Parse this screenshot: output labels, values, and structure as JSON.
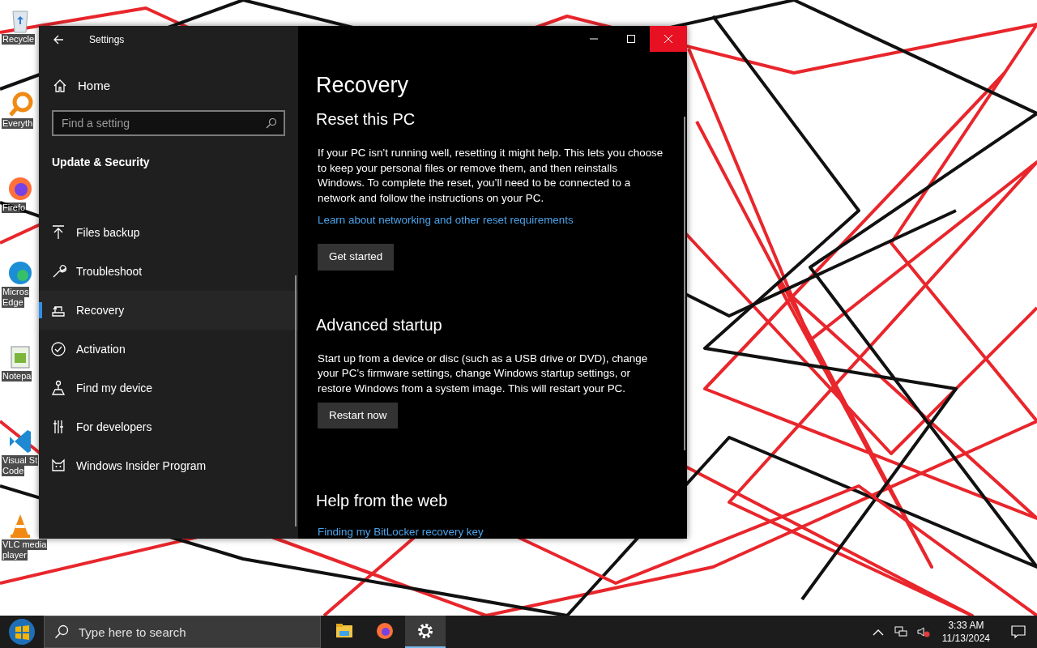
{
  "desktop_icons": [
    {
      "lines": [
        "Recycle"
      ]
    },
    {
      "lines": [
        "Everyth"
      ]
    },
    {
      "lines": [
        "Firefo"
      ]
    },
    {
      "lines": [
        "Micros",
        "Edge"
      ]
    },
    {
      "lines": [
        "Notepa"
      ]
    },
    {
      "lines": [
        "Visual St",
        "Code"
      ]
    },
    {
      "lines": [
        "VLC media",
        "player"
      ]
    }
  ],
  "window": {
    "title": "Settings"
  },
  "sidebar": {
    "home": "Home",
    "search": {
      "placeholder": "Find a setting"
    },
    "section": "Update & Security",
    "items": [
      {
        "label": "Files backup",
        "selected": false
      },
      {
        "label": "Troubleshoot",
        "selected": false
      },
      {
        "label": "Recovery",
        "selected": true
      },
      {
        "label": "Activation",
        "selected": false
      },
      {
        "label": "Find my device",
        "selected": false
      },
      {
        "label": "For developers",
        "selected": false
      },
      {
        "label": "Windows Insider Program",
        "selected": false
      }
    ]
  },
  "content": {
    "title": "Recovery",
    "sections": [
      {
        "heading": "Reset this PC",
        "text": "If your PC isn’t running well, resetting it might help. This lets you choose to keep your personal files or remove them, and then reinstalls Windows. To complete the reset, you’ll need to be connected to a network and follow the instructions on your PC.",
        "link": "Learn about networking and other reset requirements",
        "button": "Get started"
      },
      {
        "heading": "Advanced startup",
        "text": "Start up from a device or disc (such as a USB drive or DVD), change your PC’s firmware settings, change Windows startup settings, or restore Windows from a system image. This will restart your PC.",
        "button": "Restart now"
      },
      {
        "heading": "Help from the web",
        "link": "Finding my BitLocker recovery key"
      }
    ]
  },
  "taskbar": {
    "search": {
      "placeholder": "Type here to search"
    },
    "apps": [
      {
        "selected": false
      },
      {
        "selected": false
      },
      {
        "selected": true
      }
    ],
    "time": "3:33 AM",
    "date": "11/13/2024"
  }
}
